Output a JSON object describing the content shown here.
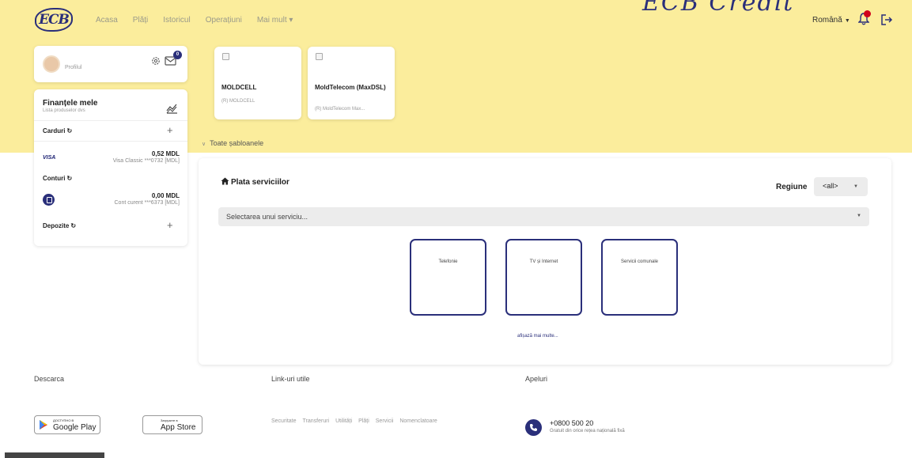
{
  "header": {
    "logo": "ECB",
    "nav": [
      "Acasa",
      "Plăți",
      "Istoricul",
      "Operațiuni",
      "Mai mult ▾"
    ],
    "brand_partial": "ECB Credit",
    "language": "Română",
    "accent": "#2a2f7a",
    "band_color": "#fbed9c"
  },
  "profile": {
    "label": "Profilul",
    "mail_badge": "0"
  },
  "finances": {
    "title": "Finanțele mele",
    "subtitle": "Lista produselor dvs",
    "cards_label": "Carduri",
    "card_brand": "VISA",
    "card_amount": "0,52 MDL",
    "card_desc": "Visa Classic ***0732 [MDL]",
    "accounts_label": "Conturi",
    "account_amount": "0,00 MDL",
    "account_desc": "Cont curent ***6373 [MDL]",
    "deposits_label": "Depozite"
  },
  "templates": {
    "items": [
      {
        "name": "MOLDCELL",
        "sub": "(R) MOLDCELL"
      },
      {
        "name": "MoldTelecom (MaxDSL)",
        "sub": "(R) MoldTelecom Max..."
      }
    ],
    "all_label": "Toate șabloanele"
  },
  "services": {
    "title": "Plata serviciilor",
    "region_label": "Regiune",
    "region_value": "<all>",
    "select_placeholder": "Selectarea unui serviciu...",
    "tiles": [
      "Telefonie",
      "TV și Internet",
      "Servicii comunale"
    ],
    "show_more": "afișază mai multe..."
  },
  "footer": {
    "download_title": "Descarca",
    "google_small": "ДОСТУПНО В",
    "google_big": "Google Play",
    "apple_small": "Загрузите в",
    "apple_big": "App Store",
    "links_title": "Link-uri utile",
    "links": [
      "Securitate",
      "Transferuri",
      "Utilități",
      "Plăți",
      "Servicii",
      "Nomenclatoare"
    ],
    "calls_title": "Apeluri",
    "phone": "+0800 500 20",
    "phone_note": "Gratuit din orice rețea națională fixă"
  }
}
